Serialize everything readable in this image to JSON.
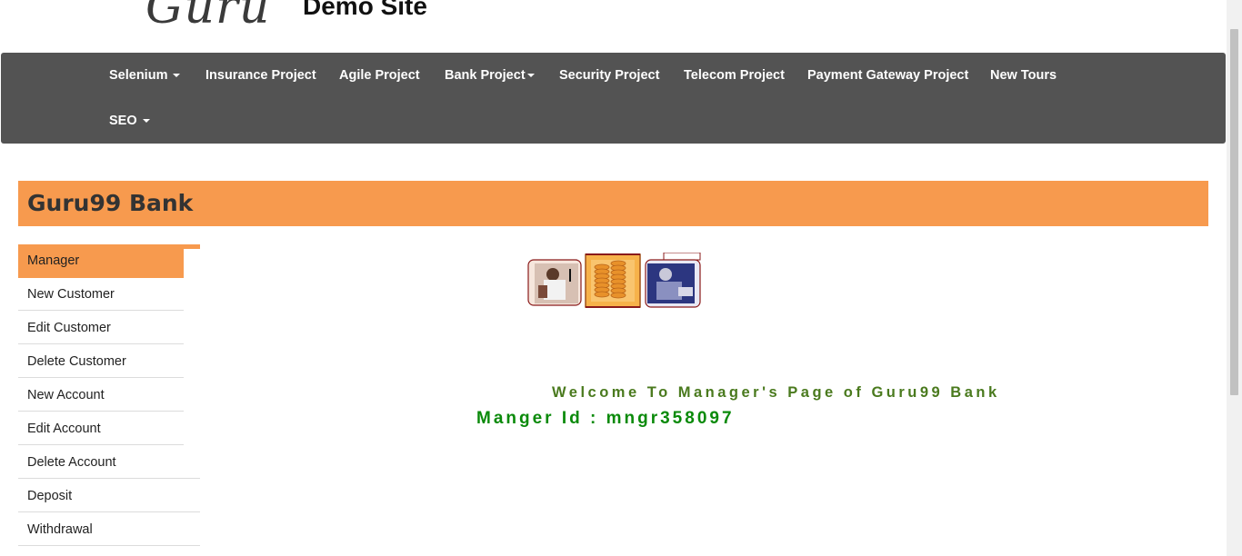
{
  "header": {
    "logo_text": "Guru",
    "site_title": "Demo Site"
  },
  "navbar": {
    "items": [
      {
        "label": "Selenium",
        "dropdown": true
      },
      {
        "label": "Insurance Project",
        "dropdown": false
      },
      {
        "label": "Agile Project",
        "dropdown": false
      },
      {
        "label": "Bank Project",
        "dropdown": true
      },
      {
        "label": "Security Project",
        "dropdown": false
      },
      {
        "label": "Telecom Project",
        "dropdown": false
      },
      {
        "label": "Payment Gateway Project",
        "dropdown": false
      },
      {
        "label": "New Tours",
        "dropdown": false
      },
      {
        "label": "SEO",
        "dropdown": true
      }
    ]
  },
  "bank": {
    "title": "Guru99 Bank"
  },
  "sidebar": {
    "items": [
      {
        "label": "Manager",
        "active": true
      },
      {
        "label": "New Customer"
      },
      {
        "label": "Edit Customer"
      },
      {
        "label": "Delete Customer"
      },
      {
        "label": "New Account"
      },
      {
        "label": "Edit Account"
      },
      {
        "label": "Delete Account"
      },
      {
        "label": "Deposit"
      },
      {
        "label": "Withdrawal"
      }
    ]
  },
  "main": {
    "welcome_text": "Welcome To Manager's Page of Guru99 Bank",
    "manager_id_text": "Manger Id : mngr358097"
  },
  "colors": {
    "navbar_bg": "#535353",
    "accent_orange": "#f79a4e",
    "welcome_green": "#4a7a1e",
    "manager_id_green": "#0a8a0a"
  }
}
